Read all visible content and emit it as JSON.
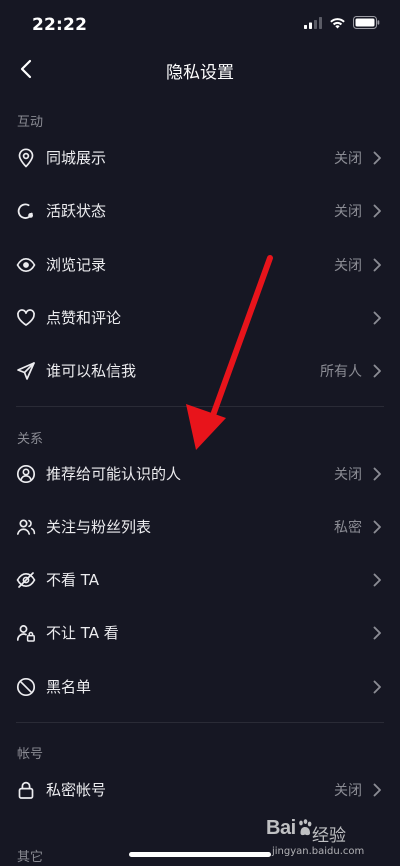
{
  "status": {
    "time": "22:22"
  },
  "nav": {
    "title": "隐私设置"
  },
  "sections": {
    "interaction": "互动",
    "relations": "关系",
    "account": "帐号",
    "other": "其它"
  },
  "rows": [
    {
      "label": "同城展示",
      "value": "关闭",
      "icon": "location-pin-icon"
    },
    {
      "label": "活跃状态",
      "value": "关闭",
      "icon": "activity-status-icon"
    },
    {
      "label": "浏览记录",
      "value": "关闭",
      "icon": "eye-icon"
    },
    {
      "label": "点赞和评论",
      "value": "",
      "icon": "heart-icon"
    },
    {
      "label": "谁可以私信我",
      "value": "所有人",
      "icon": "send-icon"
    },
    {
      "label": "推荐给可能认识的人",
      "value": "关闭",
      "icon": "user-circle-icon"
    },
    {
      "label": "关注与粉丝列表",
      "value": "私密",
      "icon": "users-icon"
    },
    {
      "label": "不看 TA",
      "value": "",
      "icon": "eye-off-icon"
    },
    {
      "label": "不让 TA 看",
      "value": "",
      "icon": "user-lock-icon"
    },
    {
      "label": "黑名单",
      "value": "",
      "icon": "block-icon"
    },
    {
      "label": "私密帐号",
      "value": "关闭",
      "icon": "lock-icon"
    }
  ],
  "watermark": {
    "brand": "Bai",
    "name": "经验",
    "url": "jingyan.baidu.com"
  },
  "colors": {
    "background": "#161723",
    "annotation_arrow": "#e8141b"
  }
}
